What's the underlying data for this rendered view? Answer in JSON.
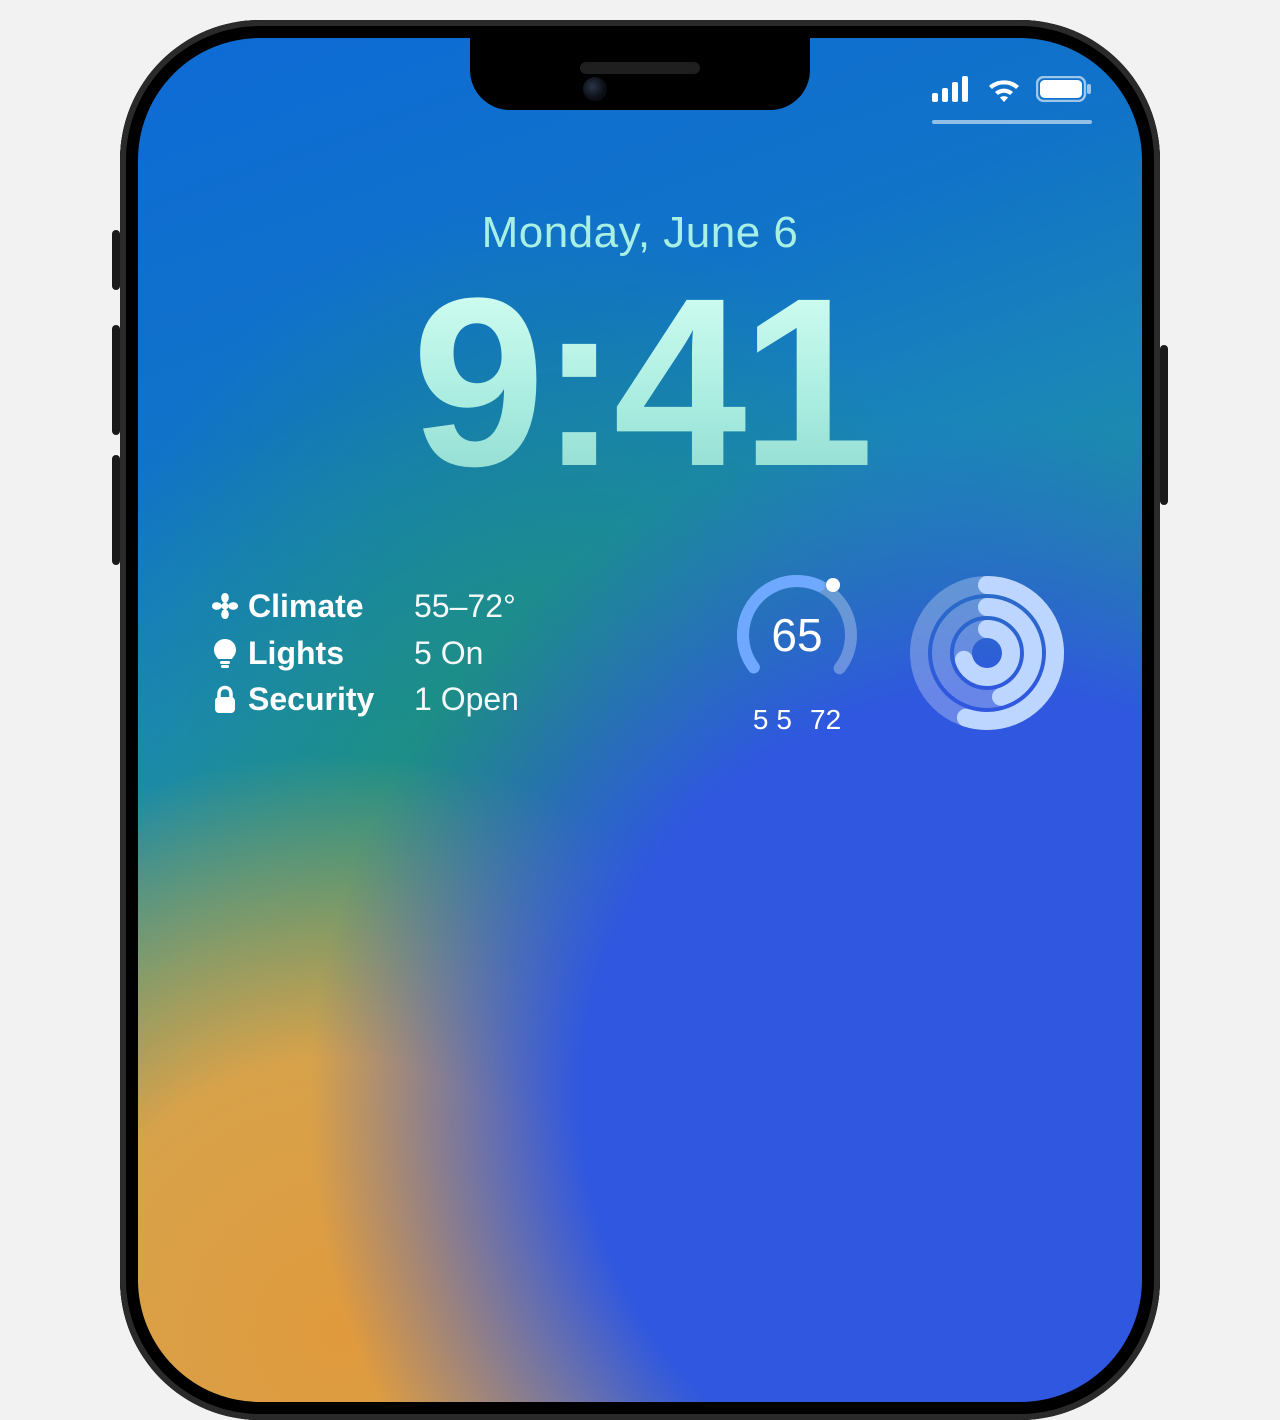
{
  "status": {
    "cellular_bars": 4,
    "wifi_strength": 3,
    "battery_pct": 100
  },
  "lockscreen": {
    "date": "Monday, June 6",
    "time": "9:41"
  },
  "home_widget": {
    "rows": [
      {
        "icon": "fan-icon",
        "label": "Climate",
        "value": "55–72°"
      },
      {
        "icon": "bulb-icon",
        "label": "Lights",
        "value": "5 On"
      },
      {
        "icon": "lock-icon",
        "label": "Security",
        "value": "1 Open"
      }
    ]
  },
  "temp_widget": {
    "current": "65",
    "low": "55",
    "high": "72",
    "gauge_fraction": 0.59
  },
  "activity_widget": {
    "rings": [
      {
        "name": "move",
        "fraction": 0.55
      },
      {
        "name": "exercise",
        "fraction": 0.45
      },
      {
        "name": "stand",
        "fraction": 0.7
      }
    ]
  },
  "colors": {
    "ring_track": "rgba(255,255,255,0.28)",
    "ring_fg": "#bcd6ff",
    "gauge_fg": "#6fa8ff"
  }
}
